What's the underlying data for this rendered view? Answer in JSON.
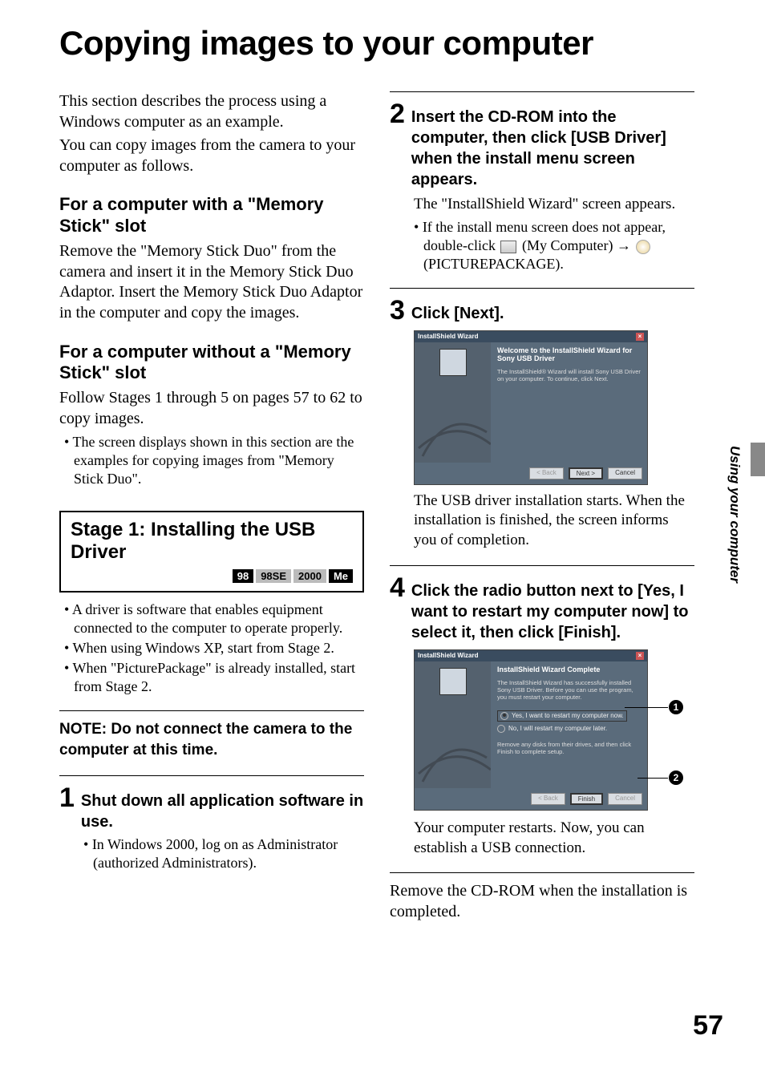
{
  "title": "Copying images to your computer",
  "side_label": "Using your computer",
  "page_number": "57",
  "intro1": "This section describes the process using a Windows computer as an example.",
  "intro2": "You can copy images from the camera to your computer as follows.",
  "sec1": {
    "head": "For a computer with a \"Memory Stick\" slot",
    "body": "Remove the \"Memory Stick Duo\" from the camera and insert it in the Memory Stick Duo Adaptor. Insert the Memory Stick Duo Adaptor in the computer and copy the images."
  },
  "sec2": {
    "head": "For a computer without a \"Memory Stick\" slot",
    "body": "Follow Stages 1 through 5 on pages 57 to 62 to copy images.",
    "note": "The screen displays shown in this section are the examples for copying images from \"Memory Stick Duo\"."
  },
  "stage": {
    "title": "Stage 1: Installing the USB Driver",
    "badges": [
      "98",
      "98SE",
      "2000",
      "Me"
    ],
    "bullets": [
      "A driver is software that enables equipment connected to the computer to operate properly.",
      "When using Windows XP, start from Stage 2.",
      "When \"PicturePackage\" is already installed, start from Stage 2."
    ]
  },
  "note_block": "NOTE: Do not connect the camera to the computer at this time.",
  "step1": {
    "num": "1",
    "head": "Shut down all application software in use.",
    "bullet": "In Windows 2000, log on as Administrator (authorized Administrators)."
  },
  "step2": {
    "num": "2",
    "head": "Insert the CD-ROM into the computer, then click [USB Driver] when the install menu screen appears.",
    "body1": "The \"InstallShield Wizard\" screen appears.",
    "bullet_pre": "If the install menu screen does not appear, double-click",
    "bullet_mid": "(My Computer)",
    "bullet_end": "(PICTUREPACKAGE).",
    "arrow": "→"
  },
  "step3": {
    "num": "3",
    "head": "Click [Next].",
    "body1": "The USB driver installation starts. When the installation is finished, the screen informs you of completion.",
    "ss": {
      "title": "InstallShield Wizard",
      "welcome": "Welcome to the InstallShield Wizard for Sony USB Driver",
      "desc": "The InstallShield® Wizard will install Sony USB Driver on your computer. To continue, click Next.",
      "btn_back": "< Back",
      "btn_next": "Next >",
      "btn_cancel": "Cancel"
    }
  },
  "step4": {
    "num": "4",
    "head": "Click the radio button next to [Yes, I want to restart my computer now] to select it, then click [Finish].",
    "body1": "Your computer restarts. Now, you can establish a USB connection.",
    "ss": {
      "title": "InstallShield Wizard",
      "complete": "InstallShield Wizard Complete",
      "desc": "The InstallShield Wizard has successfully installed Sony USB Driver. Before you can use the program, you must restart your computer.",
      "opt1": "Yes, I want to restart my computer now.",
      "opt2": "No, I will restart my computer later.",
      "remove": "Remove any disks from their drives, and then click Finish to complete setup.",
      "btn_back": "< Back",
      "btn_finish": "Finish",
      "btn_cancel": "Cancel"
    },
    "callouts": {
      "c1": "1",
      "c2": "2"
    }
  },
  "closing": "Remove the CD-ROM when the installation is completed."
}
